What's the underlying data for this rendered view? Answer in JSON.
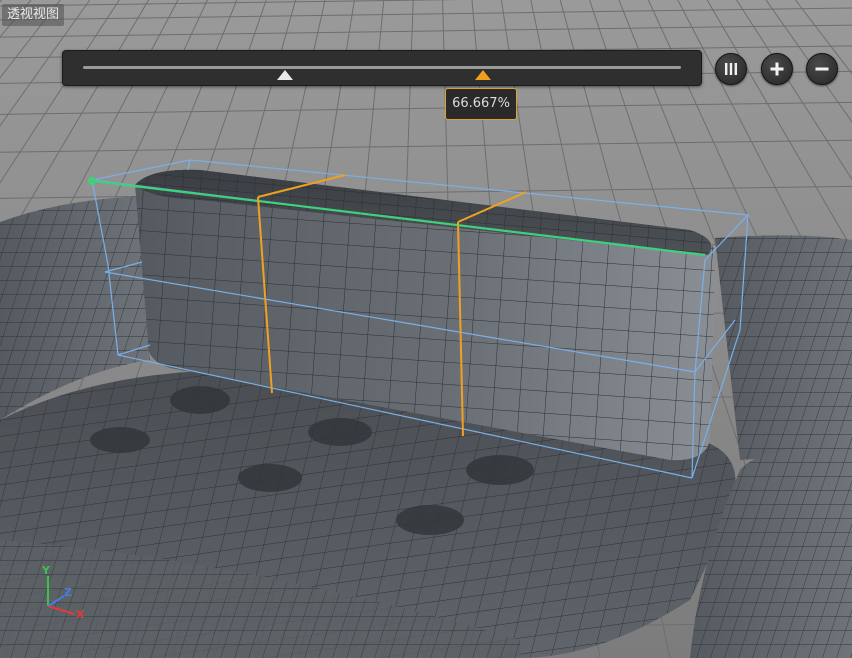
{
  "viewport": {
    "label": "透视视图",
    "background": "#8a8a8a",
    "mesh_color": "#4d5156"
  },
  "loop_cut_tool": {
    "percent_label": "66.667%",
    "ratio": 0.66667,
    "handle_color": "#f0a020",
    "buttons": [
      {
        "name": "pause",
        "icon": "pause-icon"
      },
      {
        "name": "add",
        "icon": "plus-icon"
      },
      {
        "name": "remove",
        "icon": "minus-icon"
      }
    ]
  },
  "axis": {
    "x": "X",
    "y": "Y",
    "z": "Z"
  },
  "colors": {
    "cut_line": "#f0a020",
    "selected_edge": "#3ed07a",
    "bounding_box": "#7ab0e8",
    "axis_x": "#e23b3b",
    "axis_y": "#3ec04a",
    "axis_z": "#4a7be0"
  }
}
